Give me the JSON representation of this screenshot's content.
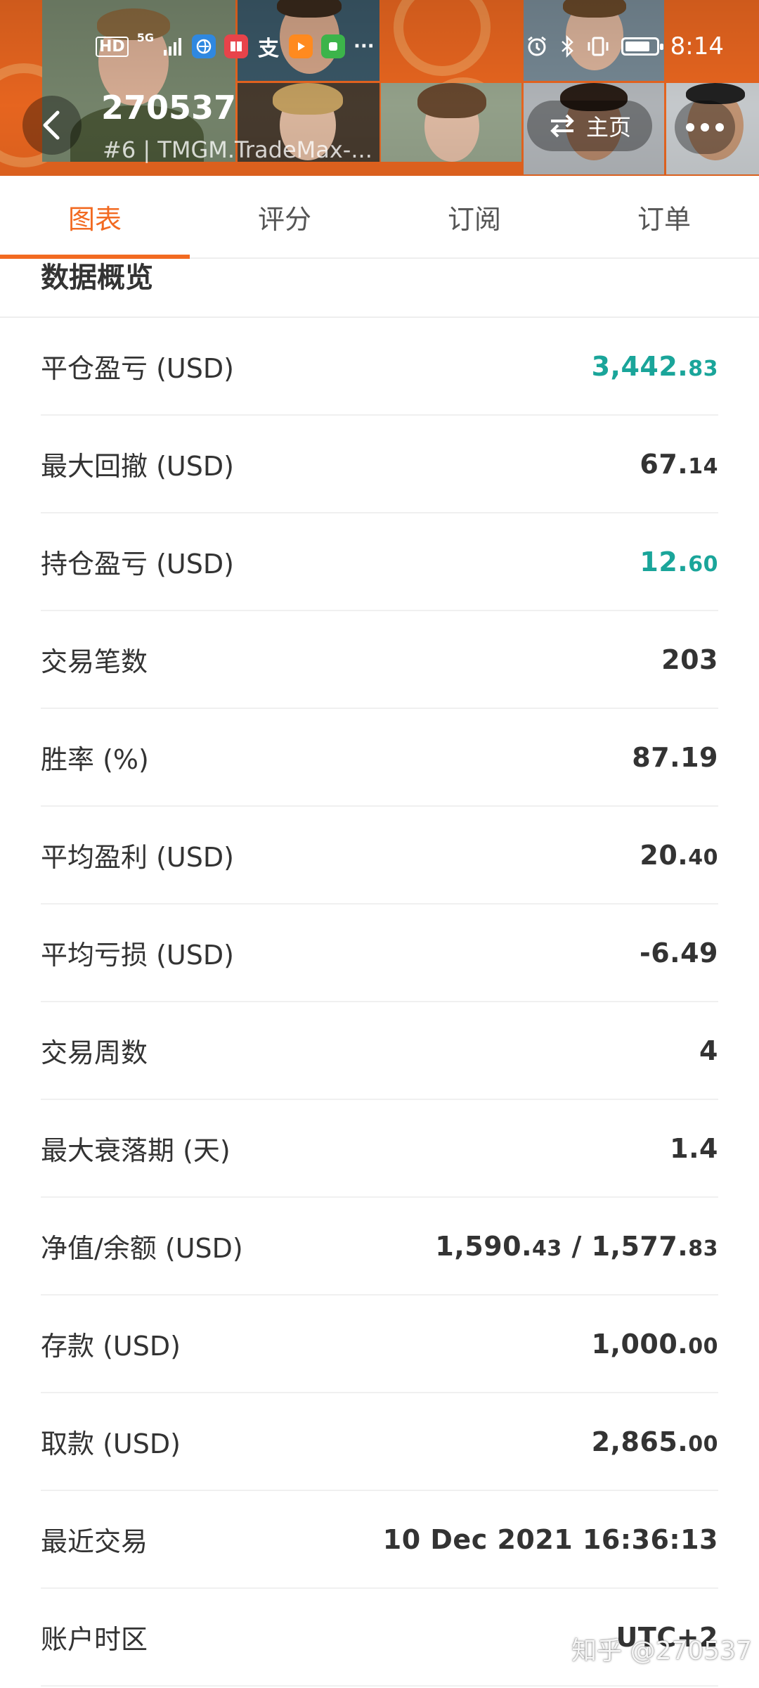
{
  "status_bar": {
    "left_text_hd": "HD",
    "left_text_5g": "5G",
    "signal_glyph": "▮",
    "app_icons": [
      "browser-icon",
      "reader-icon",
      "alipay-icon",
      "video-icon",
      "game-icon"
    ],
    "alipay_char": "支",
    "more_glyph": "···",
    "time": "8:14",
    "battery_level": 0.8
  },
  "header": {
    "title": "270537",
    "subtitle": "#6 | TMGM.TradeMax-...",
    "home_label": "主页",
    "brand_color": "#f26a21"
  },
  "tabs": [
    {
      "label": "图表",
      "active": true
    },
    {
      "label": "评分",
      "active": false
    },
    {
      "label": "订阅",
      "active": false
    },
    {
      "label": "订单",
      "active": false
    }
  ],
  "overview": {
    "title": "数据概览",
    "rows": [
      {
        "label": "平仓盈亏 (USD)",
        "value": "3,442.",
        "dec": "83",
        "color": "#1aa59a"
      },
      {
        "label": "最大回撤 (USD)",
        "value": "67.",
        "dec": "14"
      },
      {
        "label": "持仓盈亏 (USD)",
        "value": "12.",
        "dec": "60",
        "color": "#1aa59a"
      },
      {
        "label": "交易笔数",
        "value": "203",
        "dec": ""
      },
      {
        "label": "胜率 (%)",
        "value": "87.19",
        "dec": ""
      },
      {
        "label": "平均盈利 (USD)",
        "value": "20.",
        "dec": "40"
      },
      {
        "label": "平均亏损 (USD)",
        "value": "-6.49",
        "dec": ""
      },
      {
        "label": "交易周数",
        "value": "4",
        "dec": ""
      },
      {
        "label": "最大衰落期 (天)",
        "value": "1.4",
        "dec": ""
      },
      {
        "label": "净值/余额 (USD)",
        "value": "1,590.",
        "dec": "43",
        "value2": " / 1,577.",
        "dec2": "83"
      },
      {
        "label": "存款 (USD)",
        "value": "1,000.",
        "dec": "00"
      },
      {
        "label": "取款 (USD)",
        "value": "2,865.",
        "dec": "00"
      },
      {
        "label": "最近交易",
        "value": "10 Dec 2021 16:36:13",
        "dec": ""
      },
      {
        "label": "账户时区",
        "value": "UTC+2",
        "dec": ""
      }
    ]
  },
  "watermark": "知乎 @270537"
}
